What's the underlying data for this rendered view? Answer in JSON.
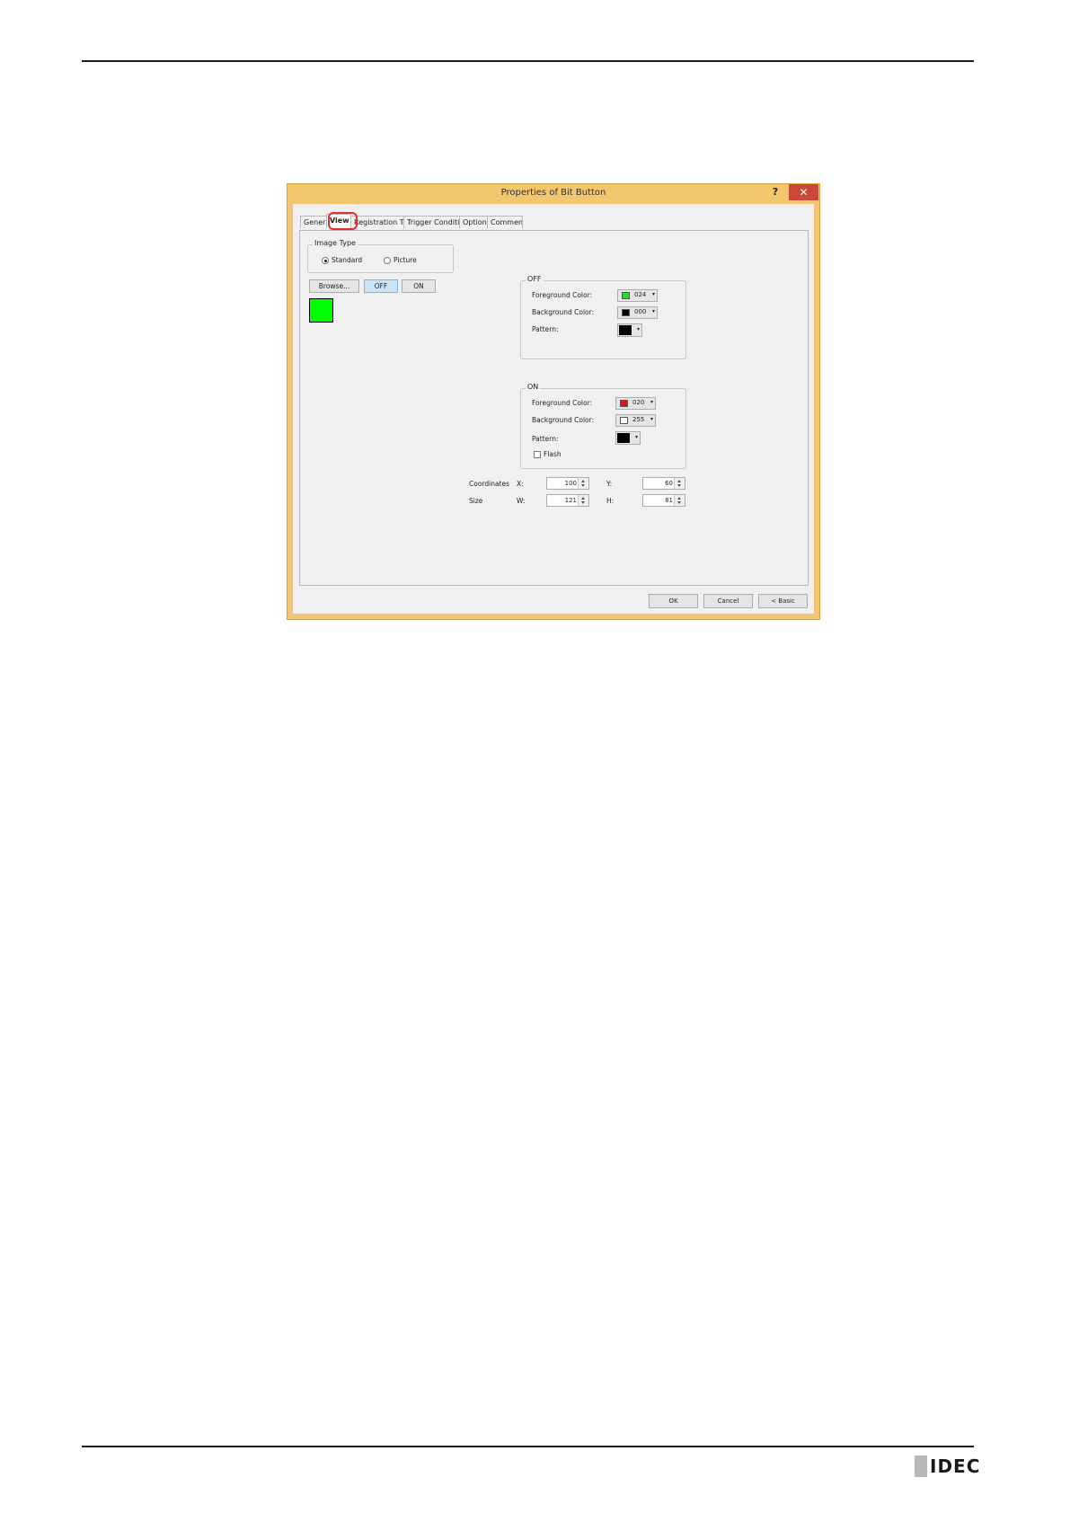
{
  "dialog": {
    "title": "Properties of Bit Button",
    "help": "?",
    "close": "✕"
  },
  "tabs": [
    "Genera",
    "View",
    "Registration Tex",
    "Trigger Condition",
    "Options",
    "Comment"
  ],
  "image_type": {
    "label": "Image Type",
    "options": [
      "Standard",
      "Picture"
    ],
    "selected": "Standard"
  },
  "buttons": {
    "browse": "Browse...",
    "off": "OFF",
    "on": "ON"
  },
  "off_group": {
    "label": "OFF",
    "foreground_label": "Foreground Color:",
    "foreground_value": "024",
    "foreground_color": "#19e619",
    "background_label": "Background Color:",
    "background_value": "000",
    "background_color": "#000000",
    "pattern_label": "Pattern:"
  },
  "on_group": {
    "label": "ON",
    "foreground_label": "Foreground Color:",
    "foreground_value": "020",
    "foreground_color": "#e31010",
    "background_label": "Background Color:",
    "background_value": "255",
    "background_color": "#ffffff",
    "pattern_label": "Pattern:",
    "flash_label": "Flash"
  },
  "coordinates": {
    "label": "Coordinates",
    "x_label": "X:",
    "x_value": "100",
    "y_label": "Y:",
    "y_value": "60"
  },
  "size": {
    "label": "Size",
    "w_label": "W:",
    "w_value": "121",
    "h_label": "H:",
    "h_value": "81"
  },
  "footer": {
    "ok": "OK",
    "cancel": "Cancel",
    "basic": "< Basic"
  },
  "logo": "IDEC"
}
